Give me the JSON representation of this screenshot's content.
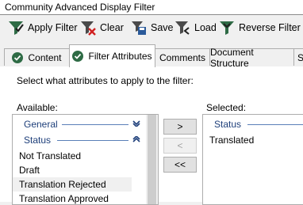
{
  "window": {
    "title": "Community Advanced Display Filter"
  },
  "toolbar": {
    "apply_label": "Apply Filter",
    "clear_label": "Clear",
    "save_label": "Save",
    "load_label": "Load",
    "reverse_label": "Reverse Filter"
  },
  "tabs": [
    {
      "label": "Content",
      "active": false
    },
    {
      "label": "Filter Attributes",
      "active": true
    },
    {
      "label": "Comments",
      "active": false
    },
    {
      "label": "Document Structure",
      "active": false
    },
    {
      "label": "S",
      "active": false
    }
  ],
  "panel": {
    "instruction": "Select what attributes to apply to the filter:",
    "available_label": "Available:",
    "selected_label": "Selected:"
  },
  "available": {
    "groups": [
      {
        "label": "General",
        "expanded": false
      },
      {
        "label": "Status",
        "expanded": true
      }
    ],
    "items": [
      "Not Translated",
      "Draft",
      "Translation Rejected",
      "Translation Approved"
    ]
  },
  "selected": {
    "group": "Status",
    "items": [
      "Translated"
    ]
  },
  "move_buttons": {
    "add": ">",
    "remove": "<",
    "remove_all": "<<"
  },
  "colors": {
    "accent": "#1e3f7a",
    "funnel": "#2e6b45",
    "clear_x": "#d02020"
  }
}
